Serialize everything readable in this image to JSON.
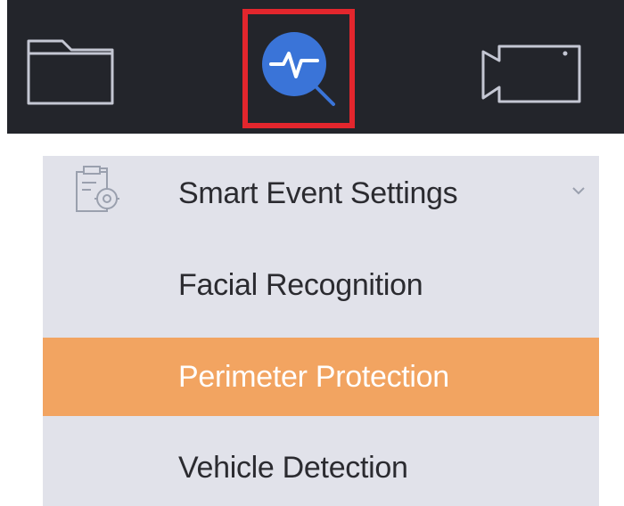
{
  "toolbar": {
    "items": [
      {
        "name": "File Management",
        "icon": "folder-icon"
      },
      {
        "name": "Smart Analysis",
        "icon": "search-analysis-icon",
        "highlighted": true
      },
      {
        "name": "Live View",
        "icon": "camera-icon"
      }
    ],
    "highlight_color": "#e3262d",
    "background": "#23252b",
    "accent": "#3a74d8"
  },
  "menu": {
    "section_label": "Smart Event Settings",
    "section_icon": "settings-clipboard-icon",
    "expand_icon": "chevron-down-icon",
    "items": [
      {
        "label": "Facial Recognition",
        "active": false
      },
      {
        "label": "Perimeter Protection",
        "active": true
      },
      {
        "label": "Vehicle Detection",
        "active": false
      }
    ],
    "active_color": "#f2a461",
    "background": "#e1e2ea"
  }
}
